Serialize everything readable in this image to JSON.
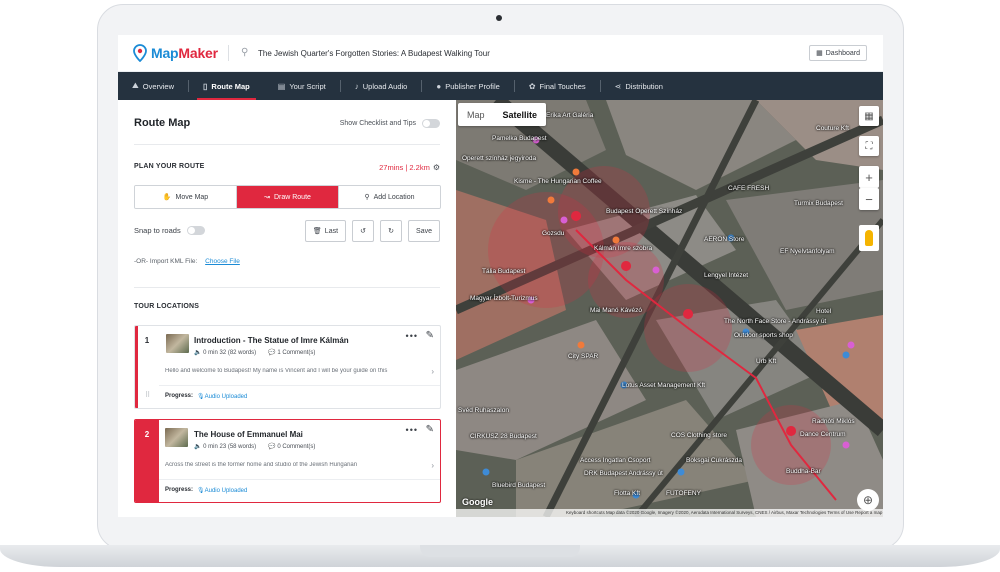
{
  "app": {
    "brand_map": "Map",
    "brand_maker": "Maker",
    "tour_title": "The Jewish Quarter's Forgotten Stories: A Budapest Walking Tour",
    "dashboard_label": "Dashboard"
  },
  "nav": {
    "items": [
      {
        "label": "Overview",
        "icon": "hiker-icon"
      },
      {
        "label": "Route Map",
        "icon": "map-icon"
      },
      {
        "label": "Your Script",
        "icon": "script-icon"
      },
      {
        "label": "Upload Audio",
        "icon": "microphone-icon"
      },
      {
        "label": "Publisher Profile",
        "icon": "user-icon"
      },
      {
        "label": "Final Touches",
        "icon": "palette-icon"
      },
      {
        "label": "Distribution",
        "icon": "share-icon"
      }
    ],
    "active": "Route Map"
  },
  "panel": {
    "title": "Route Map",
    "checklist_label": "Show Checklist and Tips",
    "plan_label": "PLAN YOUR ROUTE",
    "route_stats": "27mins | 2.2km",
    "modes": [
      "Move Map",
      "Draw Route",
      "Add Location"
    ],
    "active_mode": "Draw Route",
    "snap_label": "Snap to roads",
    "last_label": "Last",
    "save_label": "Save",
    "kml_or": "-OR-",
    "kml_label": "Import KML File:",
    "kml_link": "Choose File",
    "tour_locations_label": "TOUR LOCATIONS",
    "progress_label": "Progress:",
    "locations": [
      {
        "number": "1",
        "title": "Introduction - The Statue of Imre Kálmán",
        "duration": "0 min 32 (82 words)",
        "comments": "1 Comment(s)",
        "excerpt": "Hello and welcome to Budapest! My name is Vincent and I will be your guide on this",
        "status": "Audio Uploaded"
      },
      {
        "number": "2",
        "title": "The House of Emmanuel Mai",
        "duration": "0 min 23 (58 words)",
        "comments": "0 Comment(s)",
        "excerpt": "Across the street is the former home and studio of the Jewish Hungarian",
        "status": "Audio Uploaded"
      }
    ]
  },
  "map": {
    "type_map": "Map",
    "type_satellite": "Satellite",
    "active_type": "Satellite",
    "google": "Google",
    "labels": [
      "Erika Art Galéria",
      "Pamelka Budapest",
      "Operett színház jegyiroda",
      "Kisme - The Hungarian Coffee",
      "Budapest Operett Színház",
      "Kálmán Imre szobra",
      "Gozsdu",
      "Tália Budapest",
      "Magyar Ízbolt-Turizmus",
      "Mai Manó Kávézó",
      "City SPAR",
      "Lengyel Intézet",
      "AERON Store",
      "CAFE FRESH",
      "Turmix Budapest",
      "EF Nyelvtanfolyam",
      "The North Face Store - Andrássy út",
      "Outdoor sports shop",
      "Hotel",
      "Couture Kft",
      "Urb Kft",
      "Lotus Asset Management Kft",
      "Svéd Ruhaszalon",
      "CIRKUSZ 28 Budapest",
      "COS Clothing store",
      "Access Ingatlan Csoport",
      "Boksgai Cukrászda",
      "DRK Budapest Andrássy út",
      "Bluebird Budapest",
      "Flotta Kft",
      "FUTOFENY",
      "Radnóti Miklós",
      "Dance Centrum",
      "Buddha-Bar"
    ],
    "copyright": "Keyboard shortcuts   Map data ©2020 Google, Imagery ©2020, Aerodata International Surveys, CNES / Airbus, Maxar Technologies   Terms of Use   Report a map error"
  }
}
